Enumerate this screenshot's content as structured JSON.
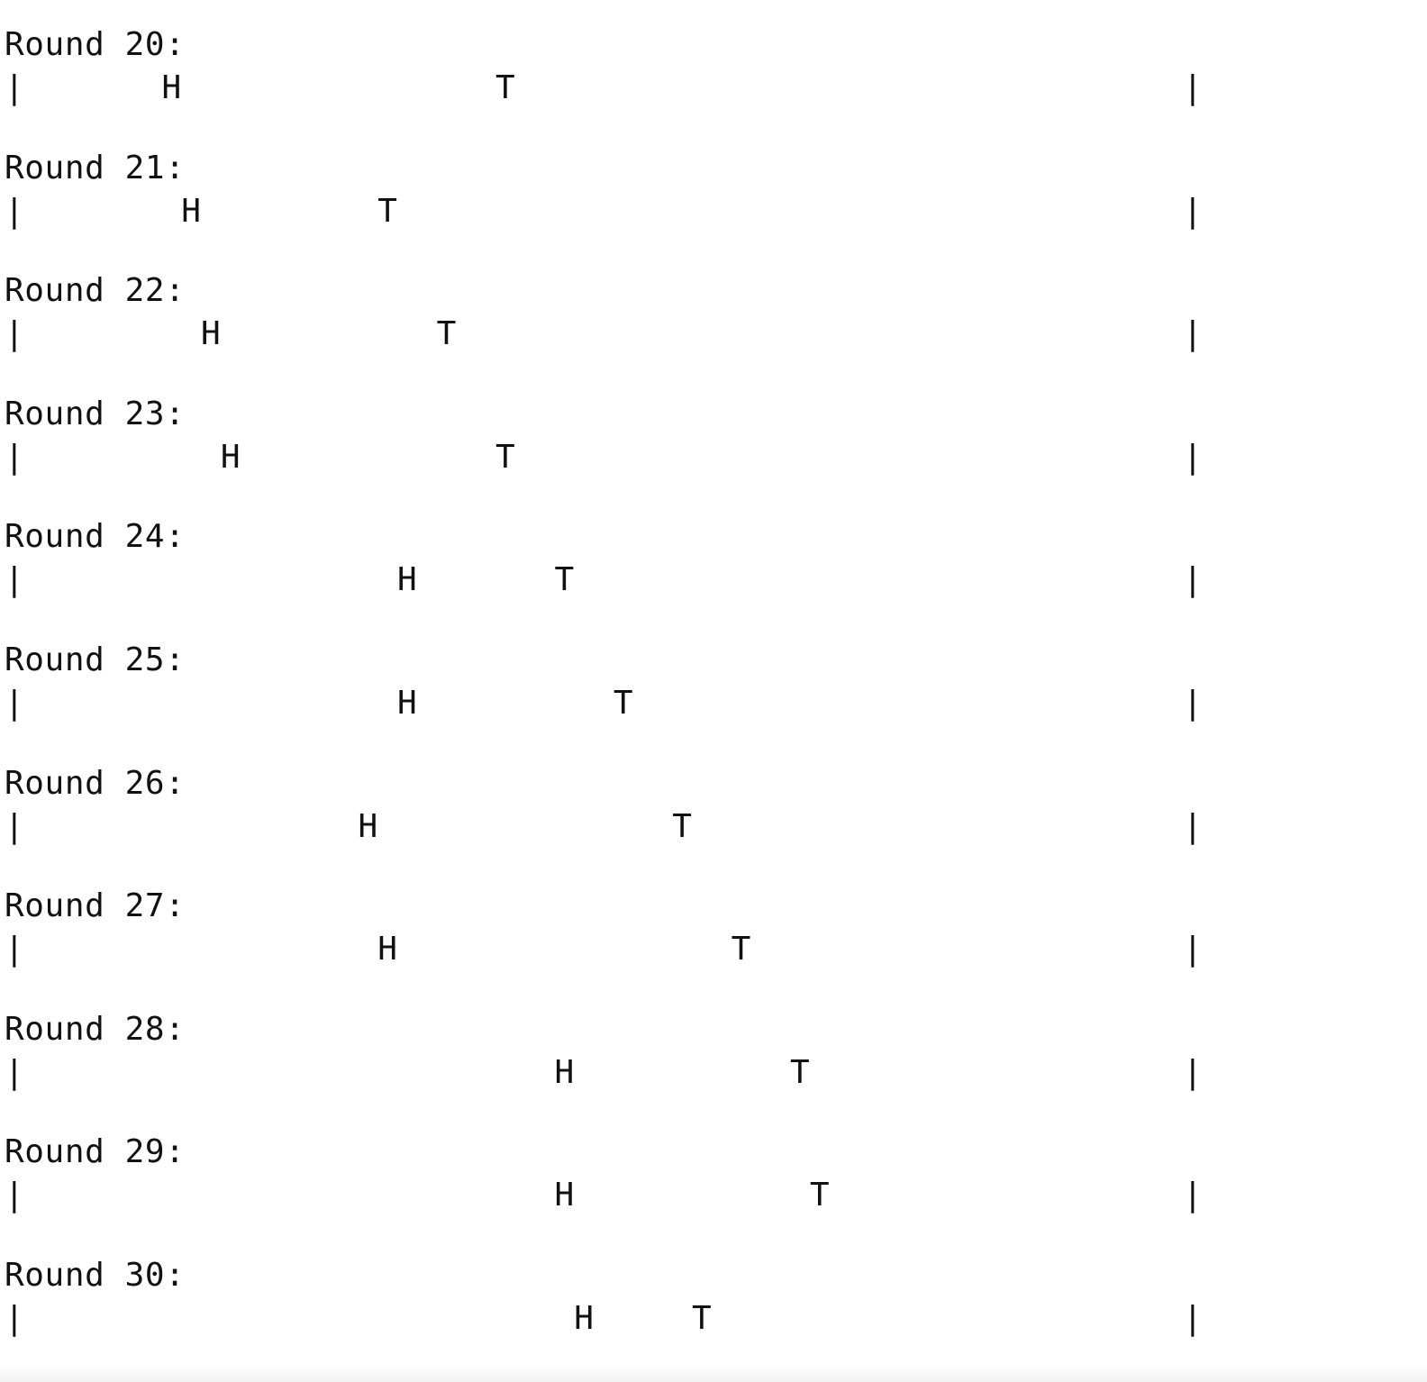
{
  "title": "",
  "cells_per_track": 60,
  "rounds": [
    {
      "label": "Round 20:",
      "left_wall": "|",
      "right_wall": "|",
      "head": "H",
      "tail": "T",
      "head_col": 8,
      "tail_col": 25,
      "wall_col": 60
    },
    {
      "label": "Round 21:",
      "left_wall": "|",
      "right_wall": "|",
      "head": "H",
      "tail": "T",
      "head_col": 9,
      "tail_col": 19,
      "wall_col": 60
    },
    {
      "label": "Round 22:",
      "left_wall": "|",
      "right_wall": "|",
      "head": "H",
      "tail": "T",
      "head_col": 10,
      "tail_col": 22,
      "wall_col": 60
    },
    {
      "label": "Round 23:",
      "left_wall": "|",
      "right_wall": "|",
      "head": "H",
      "tail": "T",
      "head_col": 11,
      "tail_col": 25,
      "wall_col": 60
    },
    {
      "label": "Round 24:",
      "left_wall": "|",
      "right_wall": "|",
      "head": "H",
      "tail": "T",
      "head_col": 20,
      "tail_col": 28,
      "wall_col": 60
    },
    {
      "label": "Round 25:",
      "left_wall": "|",
      "right_wall": "|",
      "head": "H",
      "tail": "T",
      "head_col": 20,
      "tail_col": 31,
      "wall_col": 60
    },
    {
      "label": "Round 26:",
      "left_wall": "|",
      "right_wall": "|",
      "head": "H",
      "tail": "T",
      "head_col": 18,
      "tail_col": 34,
      "wall_col": 60
    },
    {
      "label": "Round 27:",
      "left_wall": "|",
      "right_wall": "|",
      "head": "H",
      "tail": "T",
      "head_col": 19,
      "tail_col": 37,
      "wall_col": 60
    },
    {
      "label": "Round 28:",
      "left_wall": "|",
      "right_wall": "|",
      "head": "H",
      "tail": "T",
      "head_col": 28,
      "tail_col": 40,
      "wall_col": 60
    },
    {
      "label": "Round 29:",
      "left_wall": "|",
      "right_wall": "|",
      "head": "H",
      "tail": "T",
      "head_col": 28,
      "tail_col": 41,
      "wall_col": 60
    },
    {
      "label": "Round 30:",
      "left_wall": "|",
      "right_wall": "|",
      "head": "H",
      "tail": "T",
      "head_col": 29,
      "tail_col": 35,
      "wall_col": 60
    }
  ]
}
